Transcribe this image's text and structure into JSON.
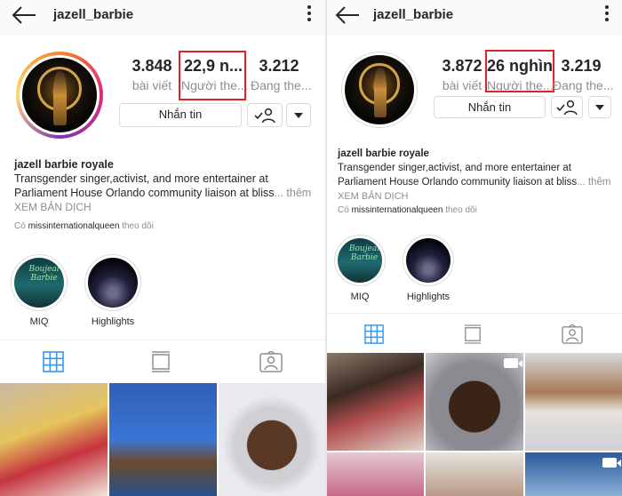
{
  "left": {
    "username": "jazell_barbie",
    "stats": [
      {
        "value": "3.848",
        "label": "bài viết"
      },
      {
        "value": "22,9 n...",
        "label": "Người the..."
      },
      {
        "value": "3.212",
        "label": "Đang the..."
      }
    ],
    "message_button": "Nhắn tin",
    "bio": {
      "name": "jazell barbie royale",
      "line1": "Transgender singer,activist, and more entertainer at",
      "line2": "Parliament House Orlando community liaison at bliss",
      "more": "... thêm",
      "translate": "XEM BẢN DỊCH"
    },
    "followed_by": {
      "prefix": "Có",
      "account": "missinternationalqueen",
      "suffix": "theo dõi"
    },
    "highlights": [
      {
        "label": "MIQ",
        "icon": "miq-highlight-cover",
        "cover_text": "Boujeal Barbie"
      },
      {
        "label": "Highlights",
        "icon": "highlights-cover"
      }
    ]
  },
  "right": {
    "username": "jazell_barbie",
    "stats": [
      {
        "value": "3.872",
        "label": "bài viết"
      },
      {
        "value": "26 nghìn",
        "label": "Người the..."
      },
      {
        "value": "3.219",
        "label": "Đang the..."
      }
    ],
    "message_button": "Nhắn tin",
    "bio": {
      "name": "jazell barbie royale",
      "line1": "Transgender singer,activist, and more entertainer at",
      "line2": "Parliament House Orlando community liaison at bliss",
      "more": "... thêm",
      "translate": "XEM BẢN DỊCH"
    },
    "followed_by": {
      "prefix": "Có",
      "account": "missinternationalqueen",
      "suffix": "theo dõi"
    },
    "highlights": [
      {
        "label": "MIQ",
        "icon": "miq-highlight-cover",
        "cover_text": "Boujeal Barbie"
      },
      {
        "label": "Highlights",
        "icon": "highlights-cover"
      }
    ]
  },
  "icons": {
    "back": "back-arrow-icon",
    "more": "more-vertical-icon",
    "following": "following-check-person-icon",
    "suggested": "caret-down-icon",
    "grid": "grid-icon",
    "feed": "feed-list-icon",
    "tagged": "tagged-person-icon",
    "video": "video-camera-icon"
  },
  "colors": {
    "highlight_box": "#e0212a",
    "active_tab": "#3897f0",
    "muted_text": "#8e8e8e"
  }
}
